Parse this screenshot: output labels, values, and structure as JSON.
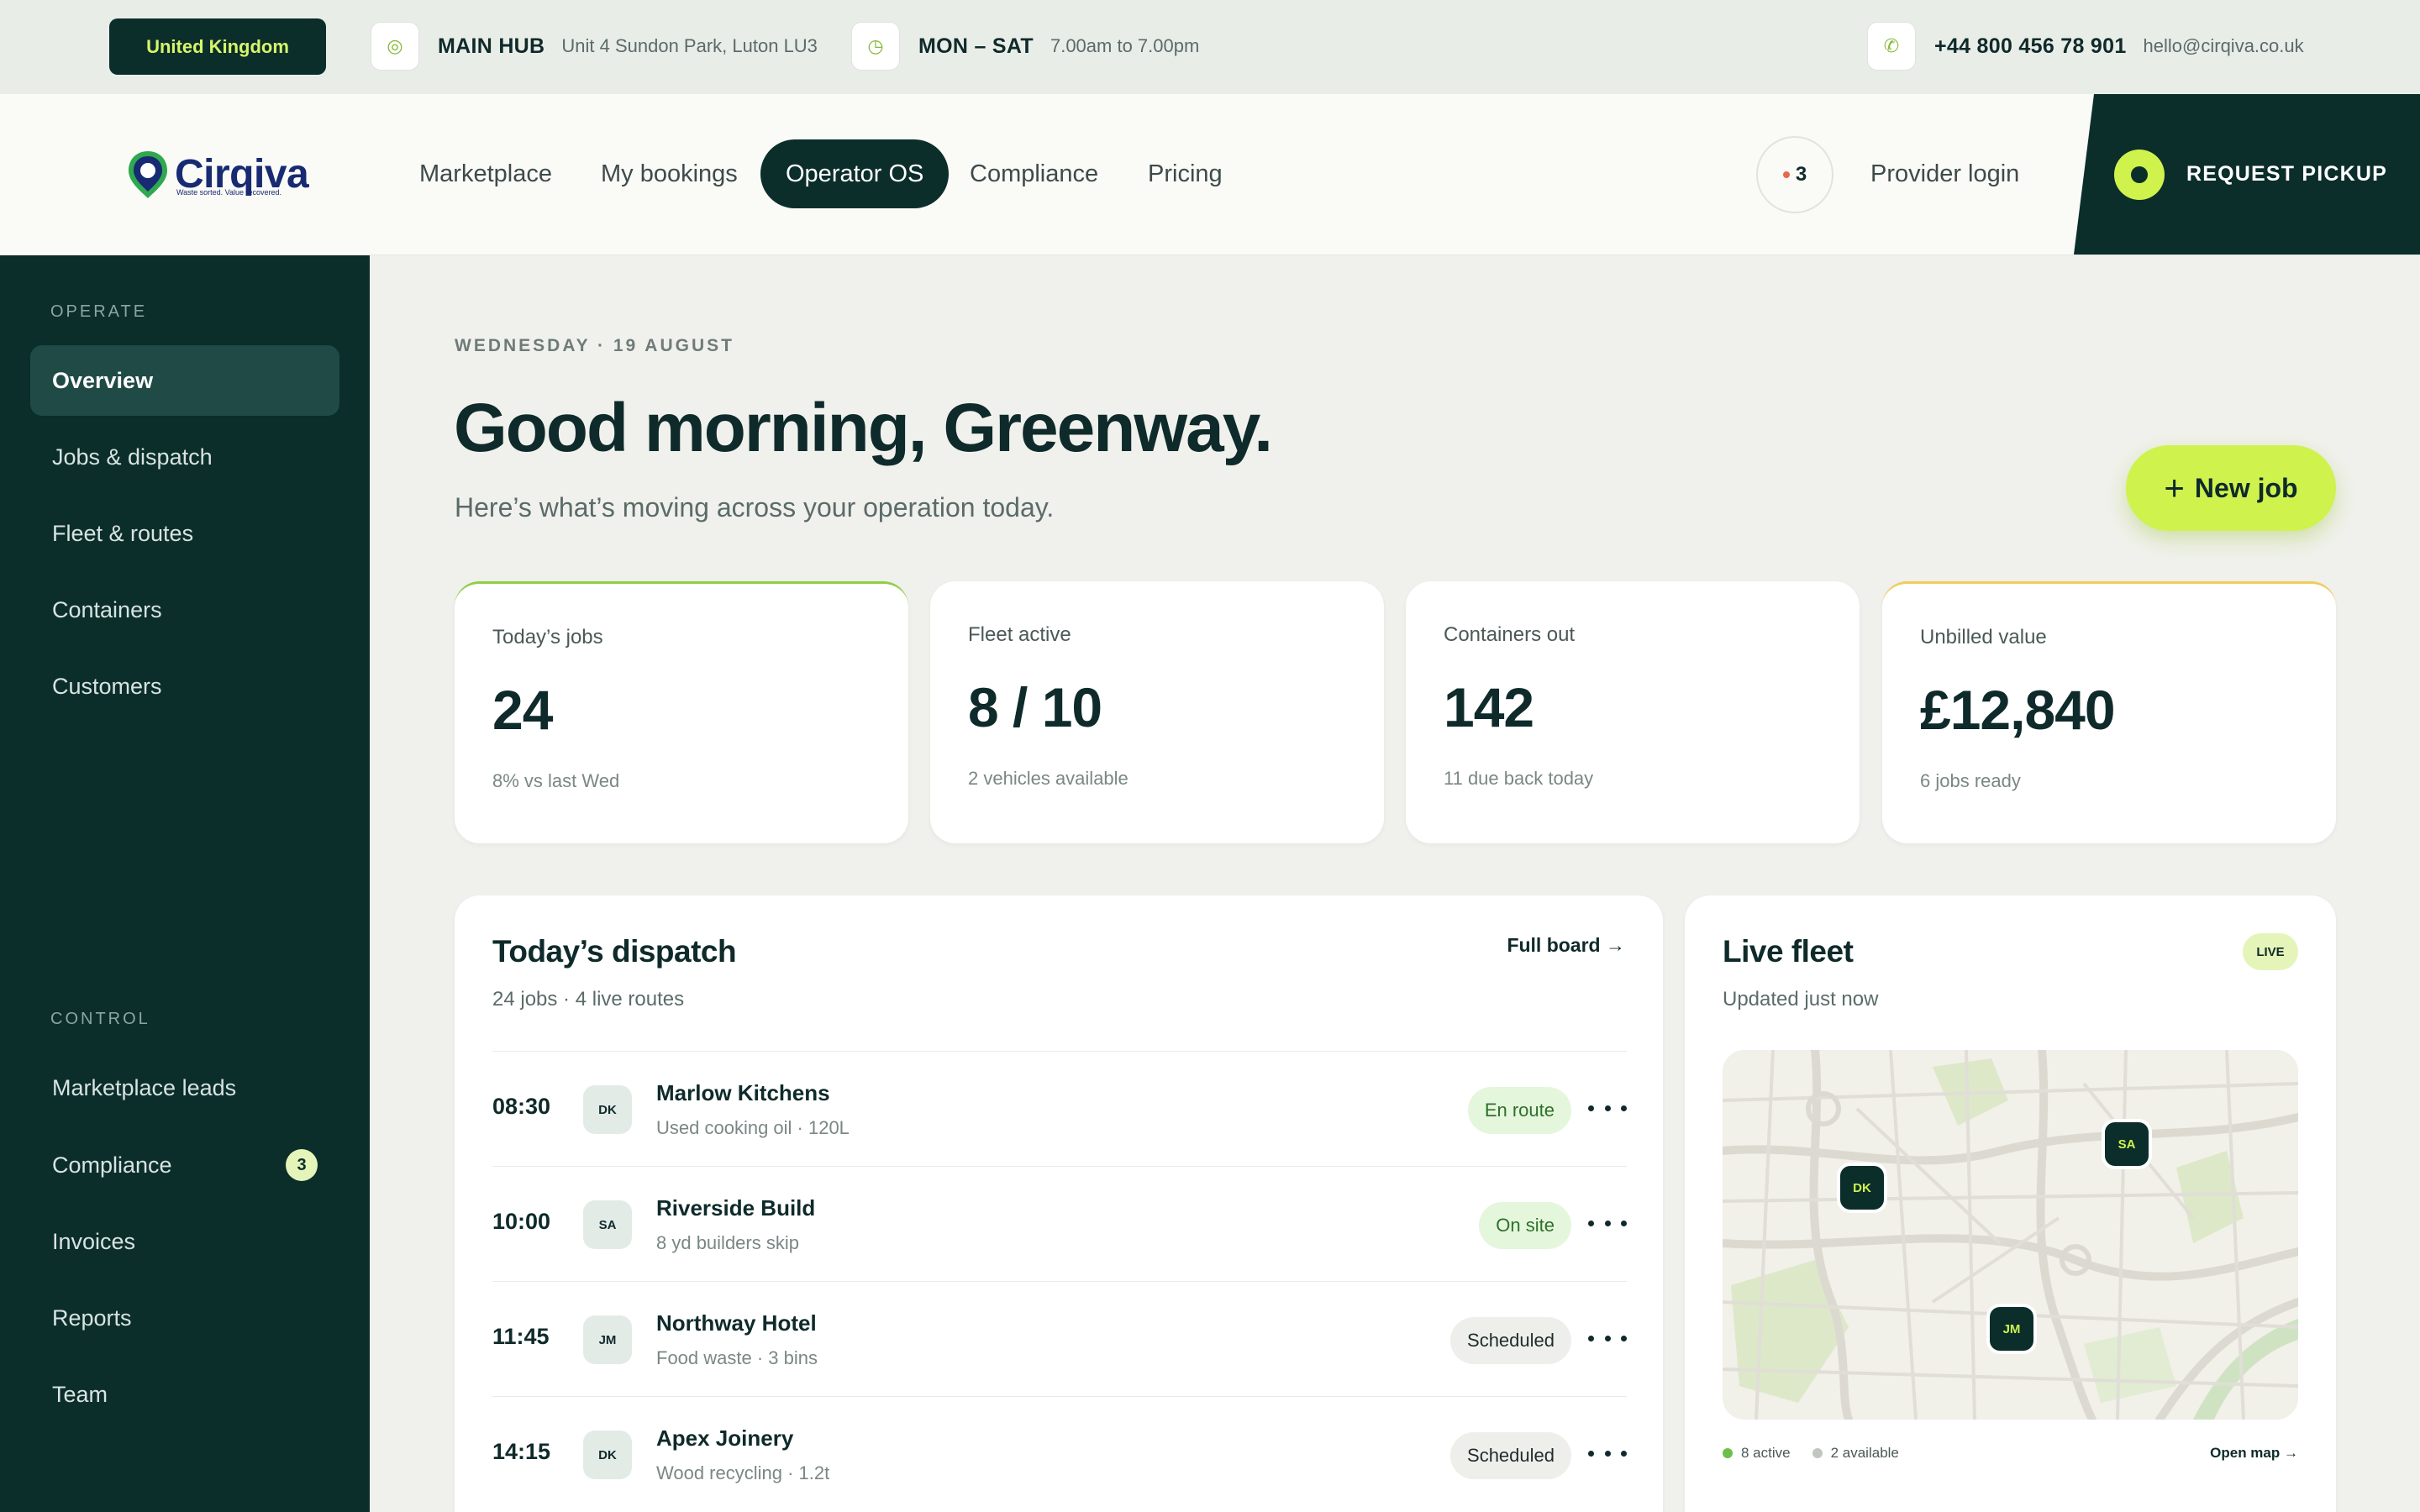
{
  "topbar": {
    "region": "United Kingdom",
    "hub_icon": "location-target-icon",
    "hub_label": "MAIN HUB",
    "hub_address": "Unit 4 Sundon Park, Luton LU3",
    "hours_icon": "clock-icon",
    "hours_label": "MON – SAT",
    "hours_value": "7.00am to 7.00pm",
    "phone_icon": "phone-icon",
    "phone": "+44 800 456 78 901",
    "email": "hello@cirqiva.co.uk"
  },
  "brand": {
    "name": "Cirqiva",
    "tagline": "Waste sorted. Value recovered.",
    "colors": {
      "navy": "#172a72",
      "green": "#2fa84f",
      "dark": "#0b2e2b",
      "lime": "#cff24d"
    }
  },
  "nav": {
    "links": [
      "Marketplace",
      "My bookings",
      "Operator OS",
      "Compliance",
      "Pricing"
    ],
    "active": "Operator OS",
    "notifications": "3",
    "provider_login": "Provider login",
    "request_pickup": "REQUEST PICKUP"
  },
  "sidebar": {
    "section_operate": "OPERATE",
    "operate_items": [
      "Overview",
      "Jobs & dispatch",
      "Fleet & routes",
      "Containers",
      "Customers"
    ],
    "section_control": "CONTROL",
    "control_items": [
      "Marketplace leads",
      "Compliance",
      "Invoices",
      "Reports",
      "Team"
    ],
    "compliance_badge": "3"
  },
  "main": {
    "date": "WEDNESDAY · 19 AUGUST",
    "greeting": "Good morning, Greenway.",
    "subtitle": "Here’s what’s moving across your operation today.",
    "new_job": "New job"
  },
  "stats": [
    {
      "label": "Today’s jobs",
      "value": "24",
      "foot": "8% vs last Wed"
    },
    {
      "label": "Fleet active",
      "value": "8 / 10",
      "foot": "2 vehicles available"
    },
    {
      "label": "Containers out",
      "value": "142",
      "foot": "11 due back today"
    },
    {
      "label": "Unbilled value",
      "value": "£12,840",
      "foot": "6 jobs ready"
    }
  ],
  "dispatch": {
    "title": "Today’s dispatch",
    "subtitle": "24 jobs · 4 live routes",
    "full_board": "Full board →",
    "jobs": [
      {
        "time": "08:30",
        "driver": "DK",
        "name": "Marlow Kitchens",
        "detail": "Used cooking oil · 120L",
        "status": "En route"
      },
      {
        "time": "10:00",
        "driver": "SA",
        "name": "Riverside Build",
        "detail": "8 yd builders skip",
        "status": "On site"
      },
      {
        "time": "11:45",
        "driver": "JM",
        "name": "Northway Hotel",
        "detail": "Food waste · 3 bins",
        "status": "Scheduled"
      },
      {
        "time": "14:15",
        "driver": "DK",
        "name": "Apex Joinery",
        "detail": "Wood recycling · 1.2t",
        "status": "Scheduled"
      }
    ]
  },
  "fleet": {
    "title": "Live fleet",
    "subtitle": "Updated just now",
    "live": "LIVE",
    "pins": [
      "DK",
      "SA",
      "JM"
    ],
    "active": "8 active",
    "available": "2 available",
    "open_map": "Open map →"
  }
}
